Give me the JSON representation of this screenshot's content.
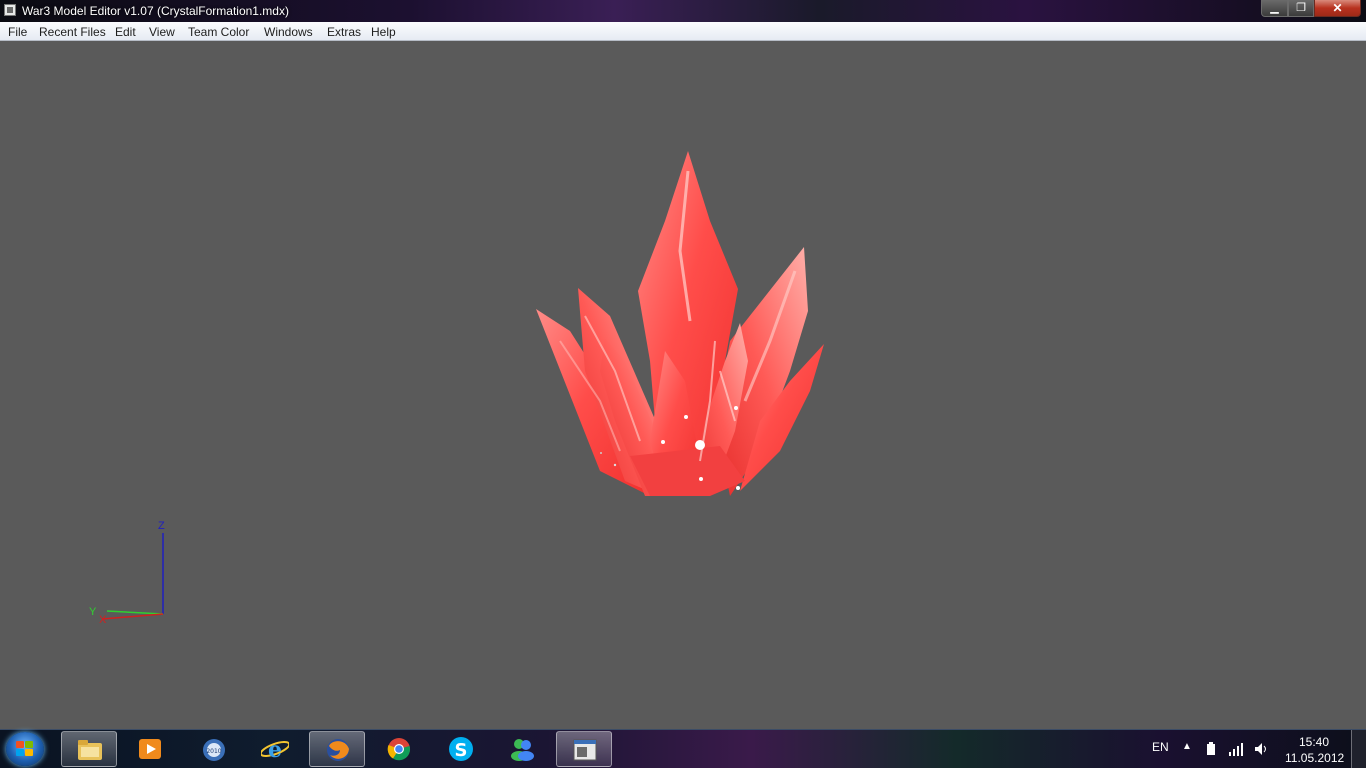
{
  "window": {
    "title": "War3 Model Editor v1.07 (CrystalFormation1.mdx)",
    "minimize_glyph": "▁",
    "maximize_glyph": "❐",
    "close_glyph": "✕"
  },
  "menu": {
    "items": [
      "File",
      "Recent Files",
      "Edit",
      "View",
      "Team Color",
      "Windows",
      "Extras",
      "Help"
    ]
  },
  "viewport": {
    "background": "#5a5a5a",
    "model_color": "#ff4a48",
    "axes": {
      "z_label": "Z",
      "y_label": "Y",
      "x_label": "X",
      "z_color": "#2020c0",
      "y_color": "#30d030",
      "x_color": "#d02020"
    }
  },
  "taskbar": {
    "icons": [
      "folder-icon",
      "media-player-icon",
      "app-2010-icon",
      "internet-explorer-icon",
      "firefox-icon",
      "chrome-icon",
      "skype-icon",
      "messenger-icon",
      "model-editor-icon"
    ],
    "language": "EN",
    "time": "15:40",
    "date": "11.05.2012"
  }
}
